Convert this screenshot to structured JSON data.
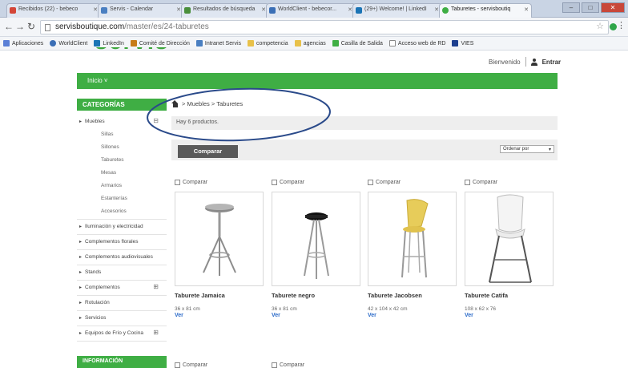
{
  "browser": {
    "tabs": [
      {
        "label": "Recibidos (22) - bebeco",
        "color": "#d44638"
      },
      {
        "label": "Servis - Calendar",
        "color": "#4a7fc1"
      },
      {
        "label": "Resultados de búsqueda",
        "color": "#4a8f3c"
      },
      {
        "label": "WorldClient - bebecor...",
        "color": "#3b6fb6"
      },
      {
        "label": "(29+) Welcome! | LinkedI",
        "color": "#1b74b5"
      },
      {
        "label": "Taburetes - servisboutiq",
        "color": "#3fae44"
      }
    ],
    "url_host": "servisboutique.com",
    "url_path": "/master/es/24-taburetes",
    "bookmarks": [
      {
        "label": "Aplicaciones",
        "color": "#5a7fd6"
      },
      {
        "label": "WorldClient",
        "color": "#3b6fb6"
      },
      {
        "label": "LinkedIn",
        "color": "#1b74b5"
      },
      {
        "label": "Comité de Dirección",
        "color": "#c77c17"
      },
      {
        "label": "Intranet Servis",
        "color": "#4a7fc1"
      },
      {
        "label": "competencia",
        "color": "#e8c14a"
      },
      {
        "label": "agencias",
        "color": "#e8c14a"
      },
      {
        "label": "Casilla de Salida",
        "color": "#3fae44"
      },
      {
        "label": "Acceso web de RD",
        "color": "#888888"
      },
      {
        "label": "VIES",
        "color": "#1d3f8f"
      }
    ]
  },
  "header": {
    "logo_text": "servis",
    "welcome": "Bienvenido",
    "login": "Entrar"
  },
  "nav": {
    "home": "Inicio  ˅"
  },
  "sidebar": {
    "title": "CATEGORÍAS",
    "muebles": "Muebles",
    "subitems": [
      "Sillas",
      "Sillones",
      "Taburetes",
      "Mesas",
      "Armarios",
      "Estanterías",
      "Accesorios"
    ],
    "items": [
      "Iluminación y electricidad",
      "Complementos florales",
      "Complementos audiovisuales",
      "Stands",
      "Complementos",
      "Rotulación",
      "Servicios",
      "Equipos de Frío y Cocina"
    ],
    "info_title": "INFORMACIÓN"
  },
  "breadcrumb": "> Muebles > Taburetes",
  "product_count": "Hay 6 productos.",
  "toolbar": {
    "compare": "Comparar",
    "sort": "Ordenar por"
  },
  "compare_label": "Comparar",
  "products": [
    {
      "name": "Taburete Jamaica",
      "dims": "36 x 81 cm",
      "link": "Ver"
    },
    {
      "name": "Taburete negro",
      "dims": "36 x 81 cm",
      "link": "Ver"
    },
    {
      "name": "Taburete Jacobsen",
      "dims": "42 x 104 x 42 cm",
      "link": "Ver"
    },
    {
      "name": "Taburete Catifa",
      "dims": "108 x 62 x 76",
      "link": "Ver"
    }
  ],
  "colors": {
    "brand_green": "#3fae44",
    "link_blue": "#2a6ac8",
    "annotation": "#2a4a8a"
  }
}
